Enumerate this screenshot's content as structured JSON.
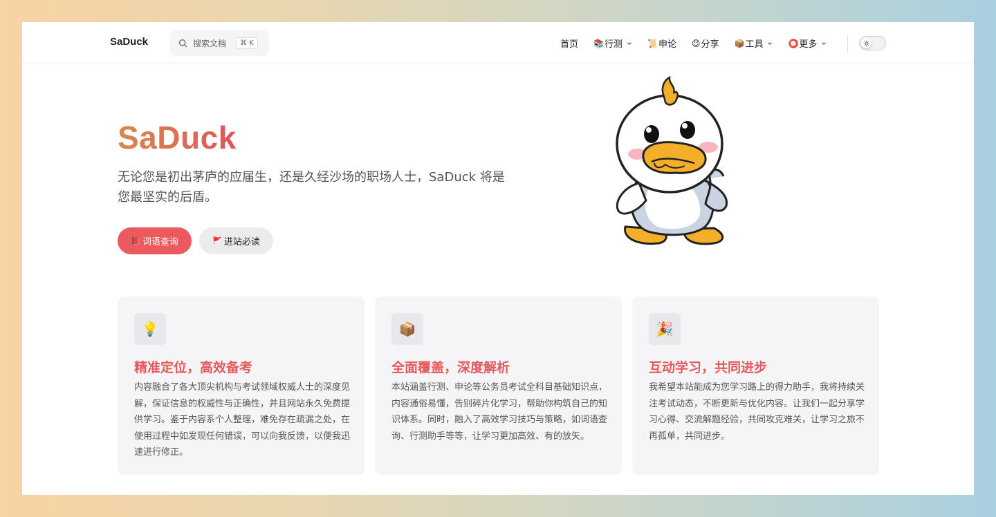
{
  "nav": {
    "brand": "SaDuck",
    "search_placeholder": "搜索文档",
    "search_shortcut": "⌘ K",
    "items": [
      {
        "emoji": "",
        "label": "首页",
        "has_dropdown": false
      },
      {
        "emoji": "📚",
        "label": "行测",
        "has_dropdown": true
      },
      {
        "emoji": "📜",
        "label": "申论",
        "has_dropdown": false
      },
      {
        "emoji": "😉",
        "label": "分享",
        "has_dropdown": false
      },
      {
        "emoji": "📦",
        "label": "工具",
        "has_dropdown": true
      },
      {
        "emoji": "⭕",
        "label": "更多",
        "has_dropdown": true
      }
    ]
  },
  "hero": {
    "title": "SaDuck",
    "subtitle": "无论您是初出茅庐的应届生，还是久经沙场的职场人士，SaDuck 将是您最坚实的后盾。",
    "primary_button": {
      "icon": "📕",
      "label": "词语查询"
    },
    "secondary_button": {
      "icon": "🚩",
      "label": "进站必读"
    }
  },
  "features": [
    {
      "icon": "💡",
      "title": "精准定位，高效备考",
      "body": "内容融合了各大顶尖机构与考试领域权威人士的深度见解，保证信息的权威性与正确性，并且网站永久免费提供学习。鉴于内容系个人整理，难免存在疏漏之处，在使用过程中如发现任何错误，可以向我反馈，以便我迅速进行修正。"
    },
    {
      "icon": "📦",
      "title": "全面覆盖，深度解析",
      "body": "本站涵盖行测、申论等公务员考试全科目基础知识点，内容通俗易懂，告别碎片化学习，帮助你构筑自己的知识体系。同时，融入了高效学习技巧与策略，如词语查询、行测助手等等，让学习更加高效、有的放矢。"
    },
    {
      "icon": "🎉",
      "title": "互动学习，共同进步",
      "body": "我希望本站能成为您学习路上的得力助手，我将持续关注考试动态，不断更新与优化内容。让我们一起分享学习心得、交流解题经验，共同攻克难关，让学习之旅不再孤单，共同进步。"
    }
  ],
  "colors": {
    "accent": "#ec5a5d",
    "title_gradient_start": "#d9884a",
    "title_gradient_end": "#e2545b",
    "card_bg": "#f5f5f7"
  }
}
